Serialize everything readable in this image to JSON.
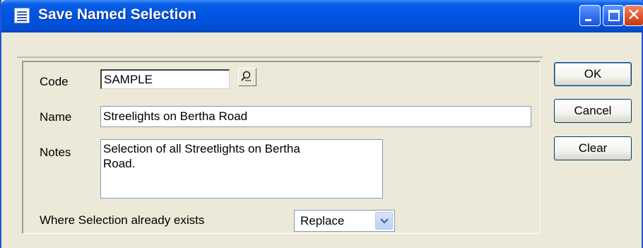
{
  "window": {
    "title": "Save Named Selection"
  },
  "form": {
    "code_label": "Code",
    "code_value": "SAMPLE",
    "name_label": "Name",
    "name_value": "Streelights on Bertha Road",
    "notes_label": "Notes",
    "notes_value": "Selection of all Streetlights on Bertha\nRoad.",
    "exists_label": "Where Selection already exists",
    "exists_value": "Replace"
  },
  "buttons": {
    "ok": "OK",
    "cancel": "Cancel",
    "clear": "Clear"
  },
  "icons": {
    "app": "list-icon",
    "lookup": "search-person-icon",
    "minimize": "minimize-icon",
    "maximize": "maximize-icon",
    "close": "close-icon",
    "dropdown": "chevron-down-icon"
  },
  "colors": {
    "titlebar": "#0054e3",
    "window_bg": "#ece9d8",
    "close_button": "#e0542e"
  }
}
